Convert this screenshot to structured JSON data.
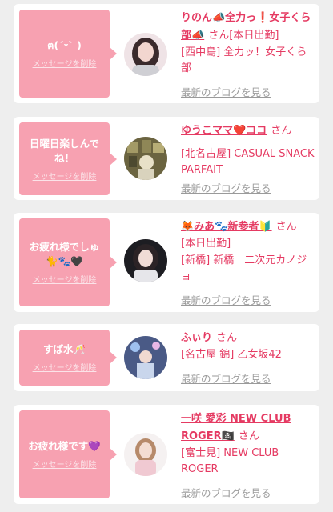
{
  "cards": [
    {
      "message": "ฅ(ˊᵕˋ )",
      "delete_label": "メッセージを削除",
      "name": "りのん📣全力っ❗️女子くら部📣",
      "san": "さん",
      "status": "[本日出勤]",
      "shop": "[西中島] 全力ッ！女子くら部",
      "blog_label": "最新のブログを見る"
    },
    {
      "message": "日曜日楽しんでね！",
      "delete_label": "メッセージを削除",
      "name": "ゆうこママ❤️ココ",
      "san": "さん",
      "status": "",
      "shop": "[北名古屋] CASUAL SNACK PARFAIT",
      "blog_label": "最新のブログを見る"
    },
    {
      "message": "お疲れ様でしゅ🐈🐾🖤",
      "delete_label": "メッセージを削除",
      "name": "🦊みあ🐾新参者🔰",
      "san": "さん",
      "status": "[本日出勤]",
      "shop": "[新橋] 新橋　二次元カノジョ",
      "blog_label": "最新のブログを見る"
    },
    {
      "message": "すぱ水🥂",
      "delete_label": "メッセージを削除",
      "name": "ふぃり",
      "san": "さん",
      "status": "",
      "shop": "[名古屋 錦] 乙女坂42",
      "blog_label": "最新のブログを見る"
    },
    {
      "message": "お疲れ様です💜",
      "delete_label": "メッセージを削除",
      "name": "一咲 愛彩 NEW CLUB ROGER🏴‍☠️",
      "san": "さん",
      "status": "",
      "shop": "[富士見] NEW CLUB ROGER",
      "blog_label": "最新のブログを見る"
    }
  ]
}
